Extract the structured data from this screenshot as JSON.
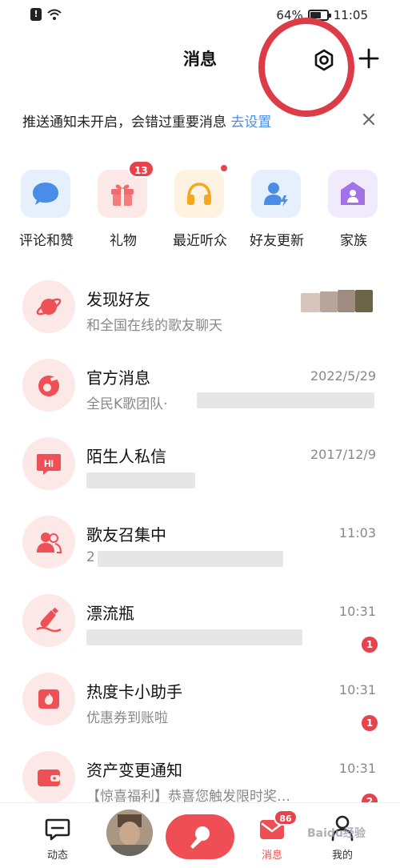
{
  "status_bar": {
    "battery_text": "64%",
    "battery_level": 0.64,
    "time": "11:05",
    "alert_glyph": "!",
    "icons": [
      "alert-icon",
      "wifi-icon",
      "battery-icon"
    ]
  },
  "header": {
    "title": "消息",
    "icons": [
      "settings-icon",
      "plus-icon"
    ],
    "annotation_color": "#dd3b46"
  },
  "notice": {
    "text": "推送通知未开启，会错过重要消息",
    "link": "去设置",
    "link_color": "#4a8de8",
    "icons": [
      "close-icon"
    ]
  },
  "categories": [
    {
      "label": "评论和赞",
      "icon": "comment-icon",
      "tile_color": "#e6f0fd",
      "icon_color": "#4a8de8",
      "badge": ""
    },
    {
      "label": "礼物",
      "icon": "gift-icon",
      "tile_color": "#fde8e8",
      "icon_color": "#f06b6b",
      "badge": "13"
    },
    {
      "label": "最近听众",
      "icon": "headphones-icon",
      "tile_color": "#fef3e0",
      "icon_color": "#f3a81f",
      "badge": "",
      "dot": true
    },
    {
      "label": "好友更新",
      "icon": "user-update-icon",
      "tile_color": "#e6f0fd",
      "icon_color": "#4a8de8",
      "badge": ""
    },
    {
      "label": "家族",
      "icon": "family-house-icon",
      "tile_color": "#f1eafd",
      "icon_color": "#a372e6",
      "badge": ""
    }
  ],
  "messages": [
    {
      "title": "发现好友",
      "preview": "和全国在线的歌友聊天",
      "time": "",
      "count": "",
      "icon": "planet-icon"
    },
    {
      "title": "官方消息",
      "preview": "全民K歌团队·",
      "time": "2022/5/29",
      "count": "",
      "icon": "official-music-icon"
    },
    {
      "title": "陌生人私信",
      "preview": "",
      "time": "2017/12/9",
      "count": "",
      "icon": "hi-bubble-icon"
    },
    {
      "title": "歌友召集中",
      "preview": "2",
      "time": "11:03",
      "count": "",
      "icon": "group-people-icon"
    },
    {
      "title": "漂流瓶",
      "preview": "",
      "time": "10:31",
      "count": "1",
      "icon": "drift-bottle-icon"
    },
    {
      "title": "热度卡小助手",
      "preview": "优惠券到账啦",
      "time": "10:31",
      "count": "1",
      "icon": "flame-card-icon"
    },
    {
      "title": "资产变更通知",
      "preview": "【惊喜福利】恭喜您触发限时奖…",
      "time": "10:31",
      "count": "2",
      "icon": "wallet-icon"
    }
  ],
  "bottom_nav": {
    "items": [
      {
        "label": "动态",
        "icon": "feed-chat-icon"
      },
      {
        "label": "",
        "icon": "user-avatar"
      },
      {
        "label": "",
        "icon": "microphone-icon"
      },
      {
        "label": "消息",
        "icon": "mail-icon",
        "badge": "86"
      },
      {
        "label": "我的",
        "icon": "profile-icon"
      }
    ],
    "accent": "#ef4e54"
  },
  "watermark": "Baidu经验",
  "colors": {
    "badge_red": "#e8434c",
    "avatar_bg": "#fde8e8",
    "icon_red": "#ee5056"
  }
}
